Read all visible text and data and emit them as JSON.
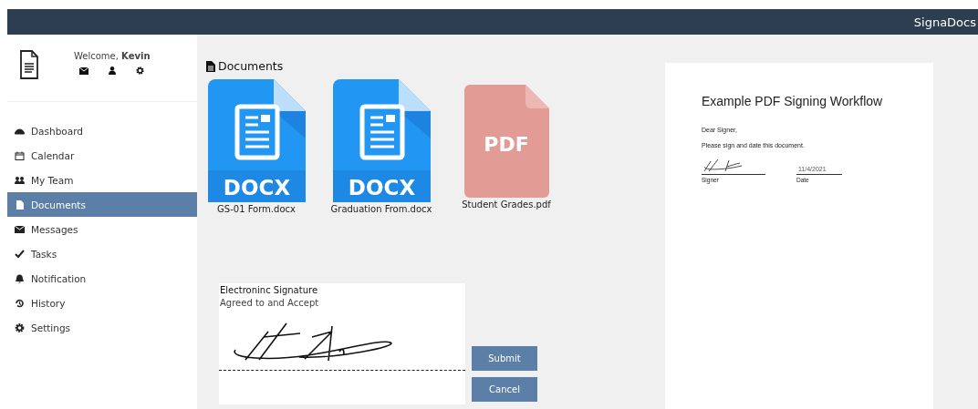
{
  "navbar": {
    "brand": "SignaDocs"
  },
  "sidebar": {
    "welcome": "Welcome, **Kevin**",
    "items": [
      {
        "label": "Dashboard",
        "selected": false
      },
      {
        "label": "Calendar",
        "selected": false
      },
      {
        "label": "My Team",
        "selected": false
      },
      {
        "label": "Documents",
        "selected": true
      },
      {
        "label": "Messages",
        "selected": false
      },
      {
        "label": "Tasks",
        "selected": false
      },
      {
        "label": "Notification",
        "selected": false
      },
      {
        "label": "History",
        "selected": false
      },
      {
        "label": "Settings",
        "selected": false
      }
    ]
  },
  "documents": {
    "title": "Documents",
    "files": [
      {
        "kind": "docx",
        "badge": "DOCX",
        "name": "GS-01 Form.docx"
      },
      {
        "kind": "docx",
        "badge": "DOCX",
        "name": "Graduation From.docx"
      },
      {
        "kind": "pdf",
        "badge": "PDF",
        "name": "Student Grades.pdf"
      }
    ]
  },
  "signature": {
    "title": "Electroninc Signature",
    "subtitle": "Agreed to and Accept",
    "buttons": [
      "Submit",
      "Cancel"
    ]
  },
  "preview": {
    "title": "Example PDF Signing Workflow",
    "greeting": "Dear Signer,",
    "body": "Please sign and date this document.",
    "date": "11/4/2021",
    "signer_label": "Signer",
    "date_label": "Date"
  }
}
